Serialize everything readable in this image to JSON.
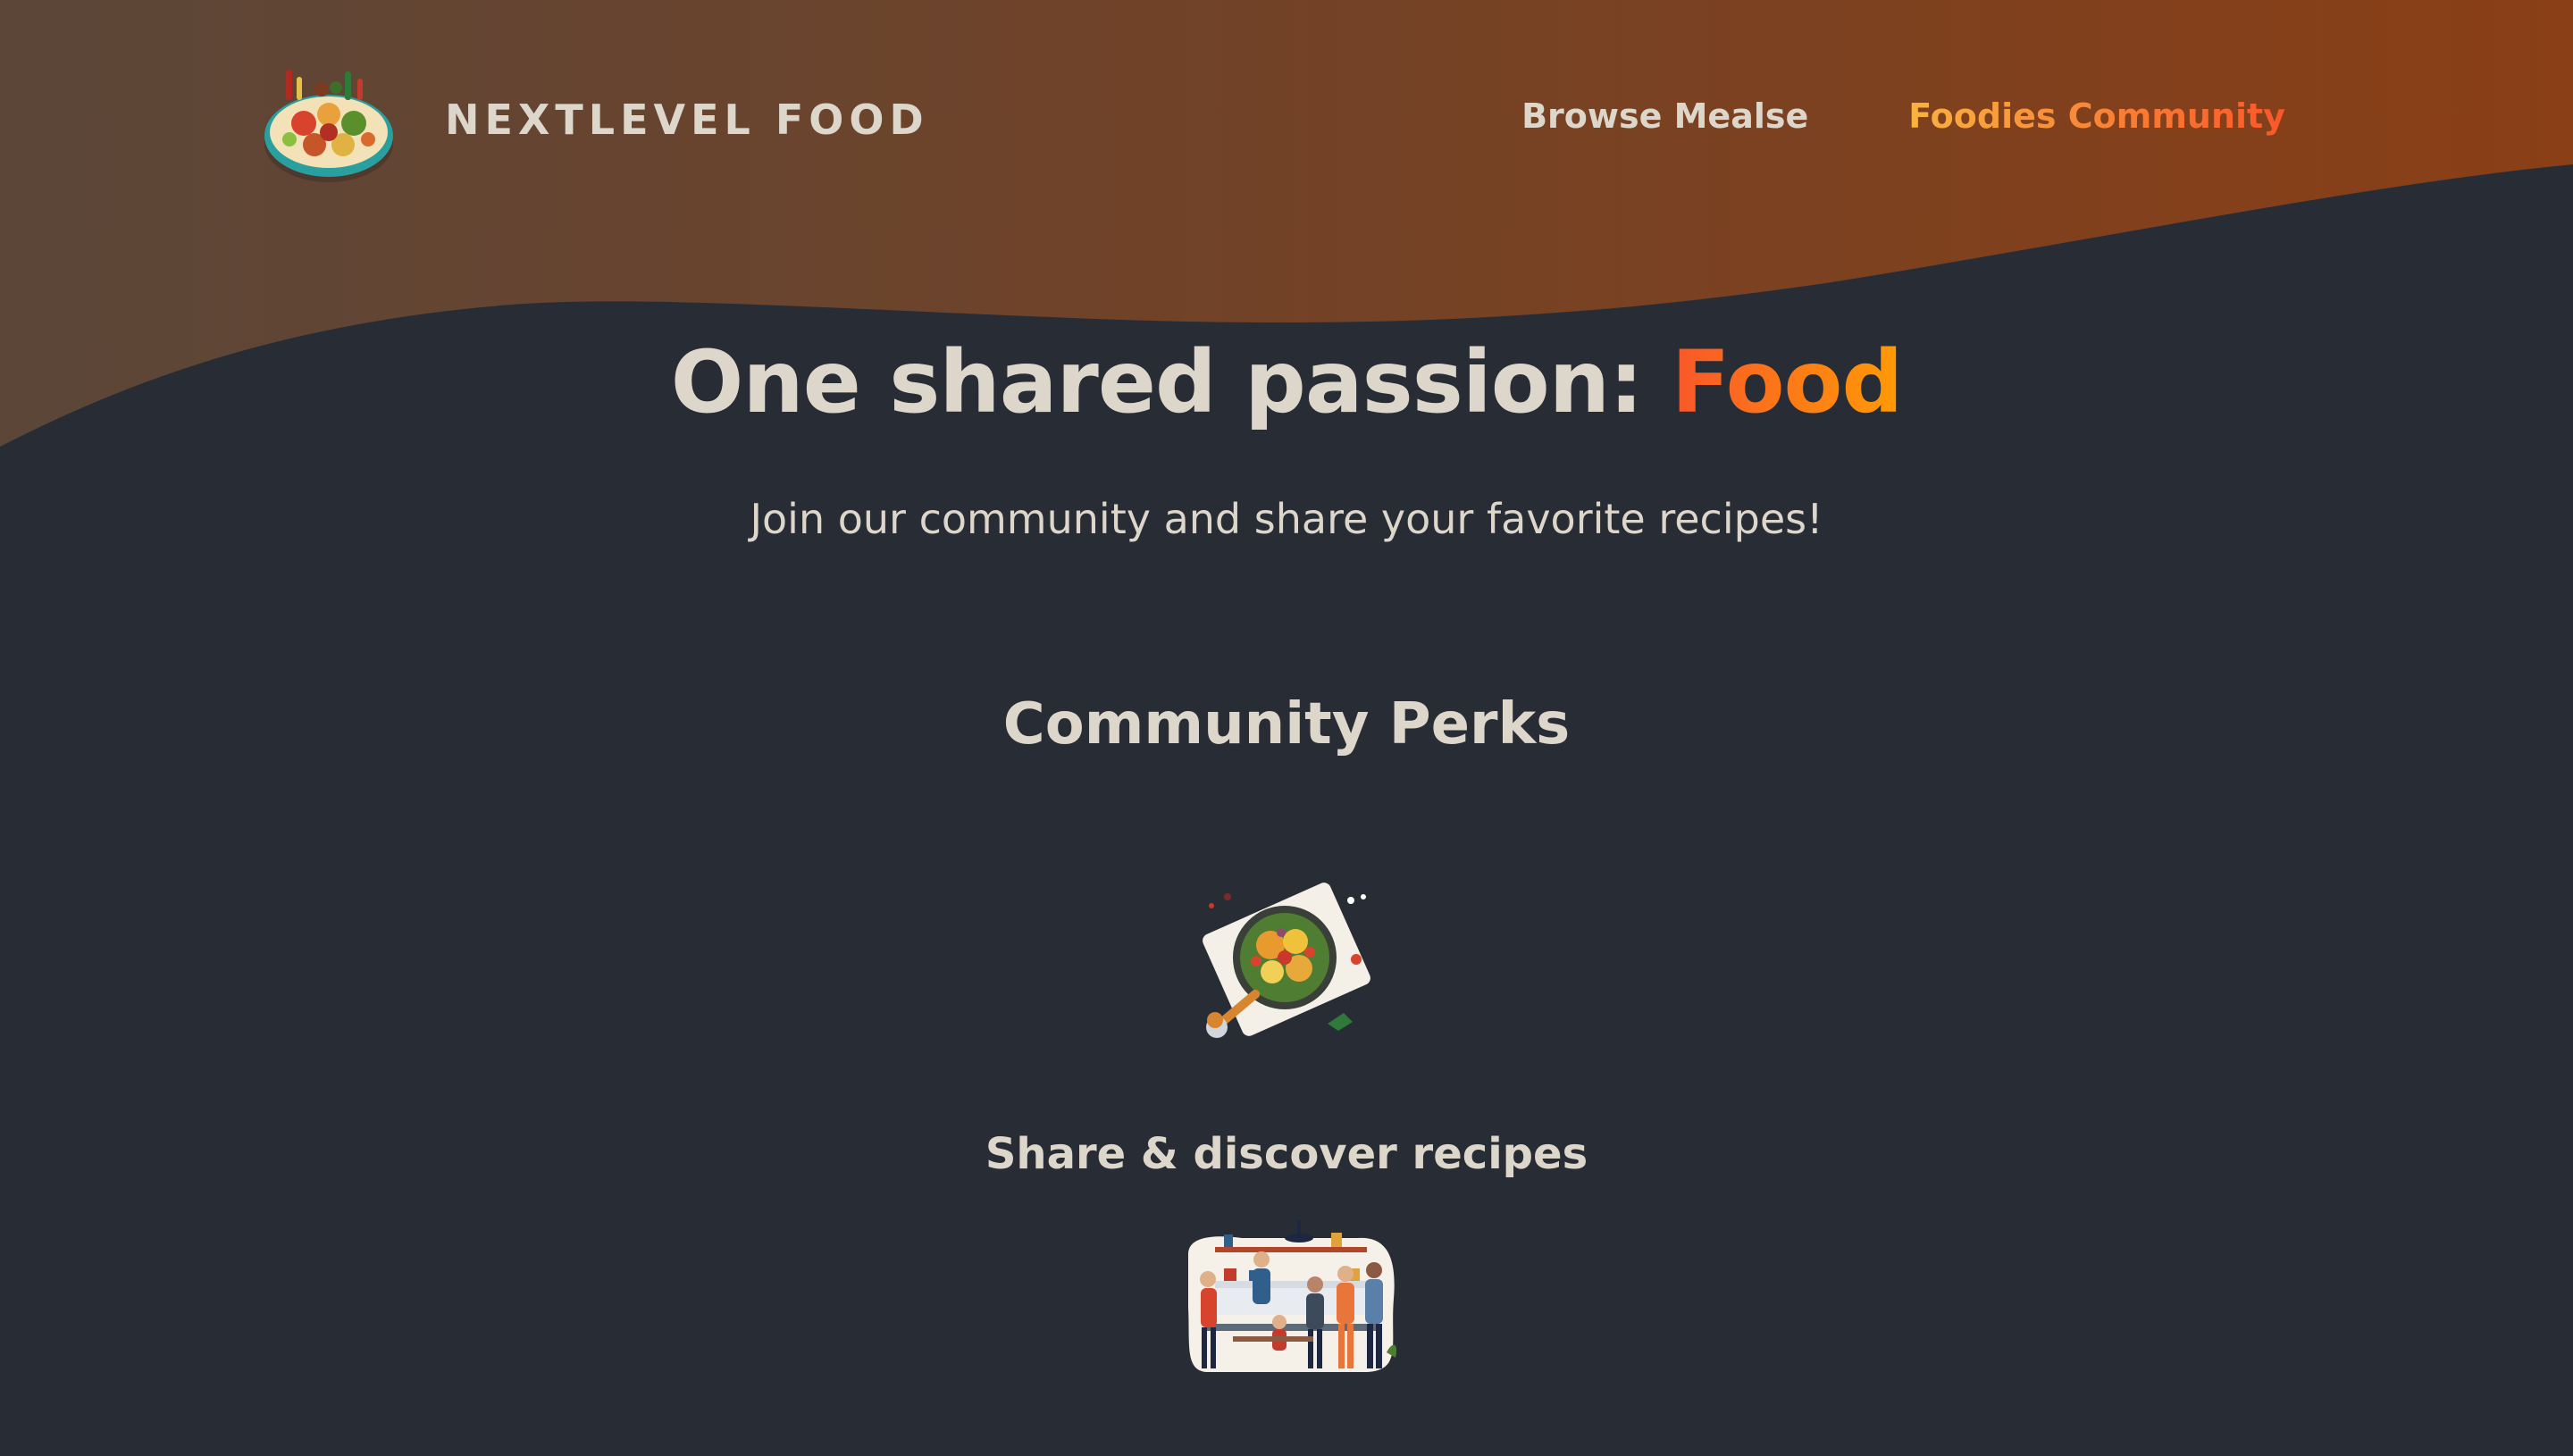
{
  "header": {
    "logo_alt": "food plate icon",
    "logo_text": "NextLevel Food",
    "nav": [
      {
        "label": "Browse Mealse",
        "active": false
      },
      {
        "label": "Foodies Community",
        "active": true
      }
    ]
  },
  "hero": {
    "title_prefix": "One shared passion: ",
    "title_highlight": "Food",
    "subtitle": "Join our community and share your favorite recipes!"
  },
  "perks": {
    "title": "Community Perks",
    "items": [
      {
        "icon": "meal-illustration-icon",
        "label": "Share & discover recipes"
      },
      {
        "icon": "community-kitchen-illustration-icon"
      }
    ]
  },
  "colors": {
    "background": "#282c34",
    "header_gradient_start": "#5b4638",
    "header_gradient_end": "#8a3f16",
    "text": "#ddd6cb",
    "accent_start": "#f9572a",
    "accent_end": "#ff9b05"
  }
}
